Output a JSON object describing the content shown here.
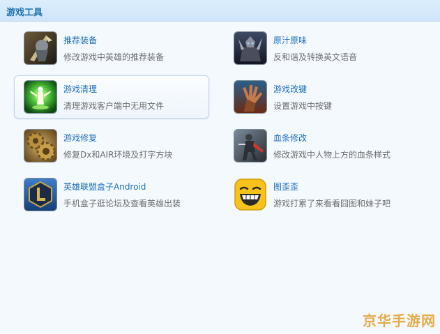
{
  "header": {
    "title": "游戏工具"
  },
  "tools": [
    {
      "name": "推荐装备",
      "desc": "修改游戏中英雄的推荐装备",
      "icon": "armored-warrior-icon"
    },
    {
      "name": "原汁原味",
      "desc": "反和谐及转换英文语音",
      "icon": "dark-knight-icon"
    },
    {
      "name": "游戏清理",
      "desc": "清理游戏客户端中无用文件",
      "icon": "glowing-spirit-icon"
    },
    {
      "name": "游戏改键",
      "desc": "设置游戏中按键",
      "icon": "claw-hand-icon"
    },
    {
      "name": "游戏修复",
      "desc": "修复Dx和AIR环境及打字方块",
      "icon": "golden-gears-icon"
    },
    {
      "name": "血条修改",
      "desc": "修改游戏中人物上方的血条样式",
      "icon": "dark-warrior-icon"
    },
    {
      "name": "英雄联盟盒子Android",
      "desc": "手机盒子逛论坛及查看英雄出装",
      "icon": "lol-box-logo-icon"
    },
    {
      "name": "图歪歪",
      "desc": "游戏打累了来看看囧图和妹子吧",
      "icon": "laughing-face-icon"
    }
  ],
  "watermark": "京华手游网"
}
